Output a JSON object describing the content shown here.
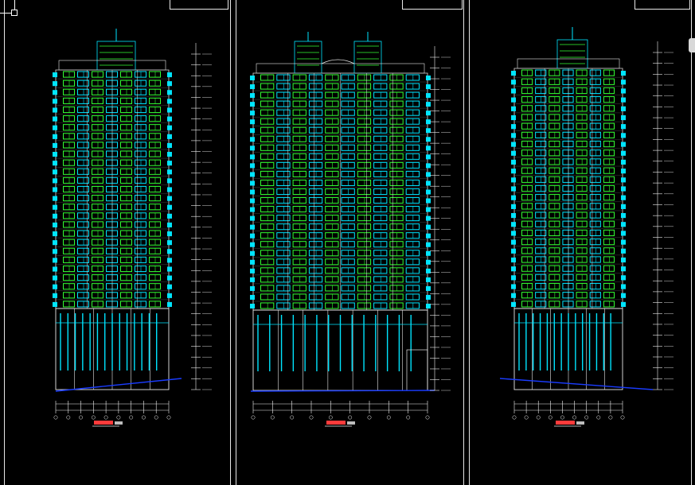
{
  "app": {
    "theme": "cad-dark"
  },
  "colors": {
    "background": "#000000",
    "outline": "#e8e8e8",
    "window_cyan": "#00e5ff",
    "window_green": "#33ff33",
    "dimension": "#f2f2f2",
    "ground": "#1a3cff",
    "annotation_red": "#ff3b3b"
  },
  "icons": {
    "crosshair": "cad-crosshair-icon",
    "scroll": "scroll-handle-icon"
  },
  "drawings": [
    {
      "id": "elevation-left",
      "floors": 27,
      "tower_type": "single-core",
      "has_side_stair": false
    },
    {
      "id": "elevation-center",
      "floors": 27,
      "tower_type": "twin-core",
      "has_side_stair": true
    },
    {
      "id": "elevation-right",
      "floors": 27,
      "tower_type": "single-core",
      "has_side_stair": false
    }
  ]
}
